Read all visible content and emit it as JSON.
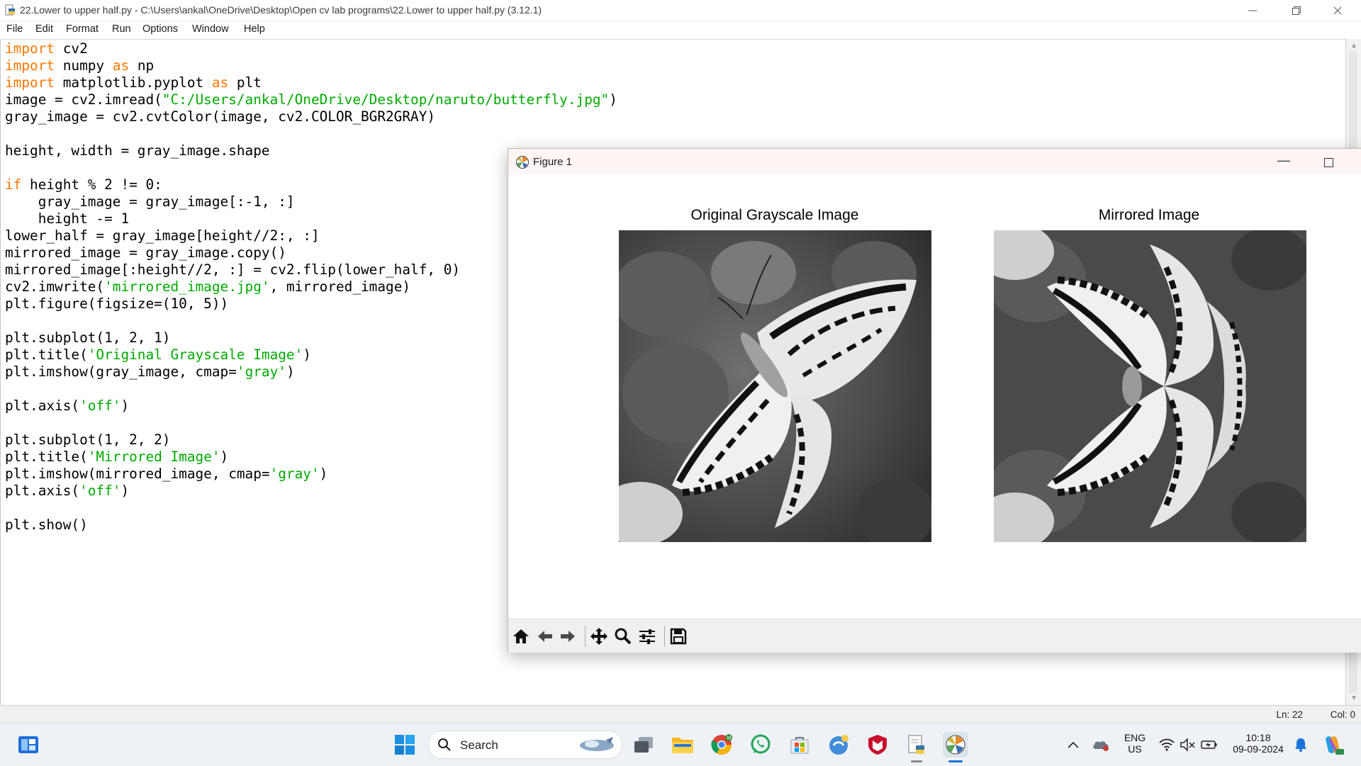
{
  "window": {
    "title": "22.Lower to upper half.py - C:\\Users\\ankal\\OneDrive\\Desktop\\Open cv lab programs\\22.Lower to upper half.py (3.12.1)",
    "controls": [
      "minimize",
      "restore",
      "close"
    ]
  },
  "menu": [
    "File",
    "Edit",
    "Format",
    "Run",
    "Options",
    "Window",
    "Help"
  ],
  "code_lines": [
    [
      [
        "kw",
        "import"
      ],
      [
        "p",
        " cv2"
      ]
    ],
    [
      [
        "kw",
        "import"
      ],
      [
        "p",
        " numpy "
      ],
      [
        "kw",
        "as"
      ],
      [
        "p",
        " np"
      ]
    ],
    [
      [
        "kw",
        "import"
      ],
      [
        "p",
        " matplotlib.pyplot "
      ],
      [
        "kw",
        "as"
      ],
      [
        "p",
        " plt"
      ]
    ],
    [
      [
        "p",
        "image = cv2.imread("
      ],
      [
        "str",
        "\"C:/Users/ankal/OneDrive/Desktop/naruto/butterfly.jpg\""
      ],
      [
        "p",
        ")"
      ]
    ],
    [
      [
        "p",
        "gray_image = cv2.cvtColor(image, cv2.COLOR_BGR2GRAY)"
      ]
    ],
    [],
    [
      [
        "p",
        "height, width = gray_image.shape"
      ]
    ],
    [],
    [
      [
        "kw",
        "if"
      ],
      [
        "p",
        " height % 2 != 0:"
      ]
    ],
    [
      [
        "p",
        "    gray_image = gray_image[:-1, :]"
      ]
    ],
    [
      [
        "p",
        "    height -= 1"
      ]
    ],
    [
      [
        "p",
        "lower_half = gray_image[height//2:, :]"
      ]
    ],
    [
      [
        "p",
        "mirrored_image = gray_image.copy()"
      ]
    ],
    [
      [
        "p",
        "mirrored_image[:height//2, :] = cv2.flip(lower_half, 0)"
      ]
    ],
    [
      [
        "p",
        "cv2.imwrite("
      ],
      [
        "str",
        "'mirrored_image.jpg'"
      ],
      [
        "p",
        ", mirrored_image)"
      ]
    ],
    [
      [
        "p",
        "plt.figure(figsize=(10, 5))"
      ]
    ],
    [],
    [
      [
        "p",
        "plt.subplot(1, 2, 1)"
      ]
    ],
    [
      [
        "p",
        "plt.title("
      ],
      [
        "str",
        "'Original Grayscale Image'"
      ],
      [
        "p",
        ")"
      ]
    ],
    [
      [
        "p",
        "plt.imshow(gray_image, cmap="
      ],
      [
        "str",
        "'gray'"
      ],
      [
        "p",
        ")"
      ]
    ],
    [],
    [
      [
        "p",
        "plt.axis("
      ],
      [
        "str",
        "'off'"
      ],
      [
        "p",
        ")"
      ]
    ],
    [],
    [
      [
        "p",
        "plt.subplot(1, 2, 2)"
      ]
    ],
    [
      [
        "p",
        "plt.title("
      ],
      [
        "str",
        "'Mirrored Image'"
      ],
      [
        "p",
        ")"
      ]
    ],
    [
      [
        "p",
        "plt.imshow(mirrored_image, cmap="
      ],
      [
        "str",
        "'gray'"
      ],
      [
        "p",
        ")"
      ]
    ],
    [
      [
        "p",
        "plt.axis("
      ],
      [
        "str",
        "'off'"
      ],
      [
        "p",
        ")"
      ]
    ],
    [],
    [
      [
        "p",
        "plt.show()"
      ]
    ]
  ],
  "status": {
    "line": "Ln: 22",
    "col": "Col: 0"
  },
  "figure": {
    "title": "Figure 1",
    "subplot1_title": "Original Grayscale Image",
    "subplot2_title": "Mirrored Image",
    "toolbar": [
      "home",
      "back",
      "forward",
      "pan",
      "zoom",
      "configure-subplots",
      "save"
    ]
  },
  "taskbar": {
    "search_label": "Search",
    "language": "ENG",
    "region": "US",
    "time": "10:18",
    "date": "09-09-2024",
    "apps": [
      "start",
      "search",
      "task-view",
      "file-explorer",
      "chrome",
      "whatsapp",
      "microsoft-store",
      "python",
      "mcafee",
      "idle",
      "matplotlib"
    ]
  },
  "colors": {
    "keyword": "#ff7700",
    "string": "#00aa00",
    "taskbar_bg": "#eef2f7",
    "figure_titlebar": "#fff5f5",
    "toolbar_bg": "#f0f0f0"
  }
}
